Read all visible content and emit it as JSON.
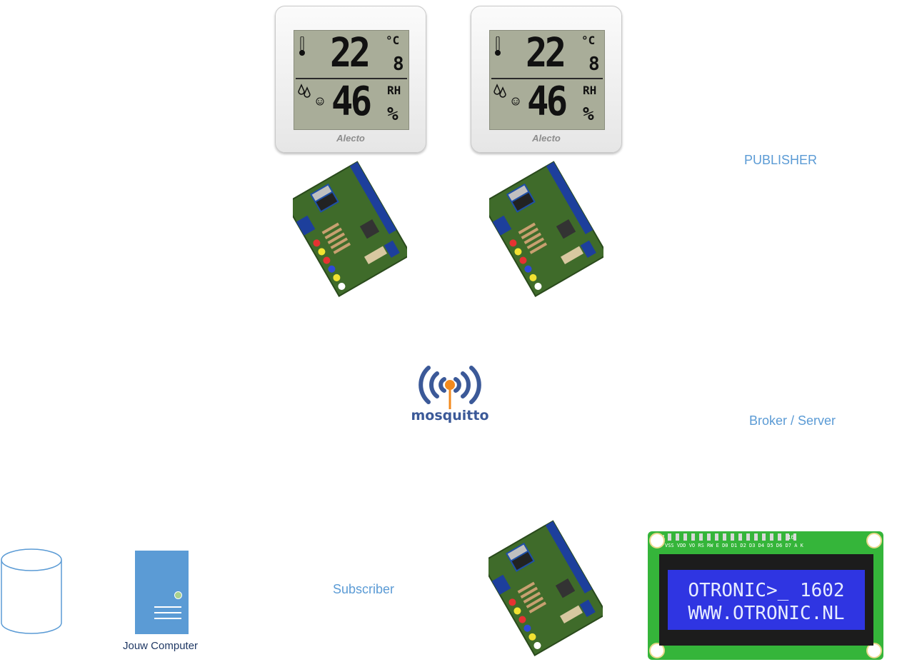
{
  "labels": {
    "publisher": "PUBLISHER",
    "broker": "Broker / Server",
    "subscriber": "Subscriber",
    "computer": "Jouw Computer"
  },
  "thermometers": [
    {
      "temp_main": "22",
      "temp_dec": "8",
      "temp_unit": "°C",
      "humidity": "46",
      "rh": "RH",
      "pct": "%",
      "brand": "Alecto"
    },
    {
      "temp_main": "22",
      "temp_dec": "8",
      "temp_unit": "°C",
      "humidity": "46",
      "rh": "RH",
      "pct": "%",
      "brand": "Alecto"
    }
  ],
  "mosquitto": {
    "logo_text": "mosquitto"
  },
  "lcd_module": {
    "line1": "OTRONIC>_ 1602",
    "line2": "WWW.OTRONIC.NL",
    "pin_labels": "VSS VDD VO RS RW E D0 D1 D2 D3 D4 D5 D6 D7 A K",
    "pin_1": "1",
    "pin_16": "16"
  },
  "colors": {
    "label_blue": "#5b9bd5",
    "server_blue": "#5b9bd5",
    "mosquitto_blue": "#3b5998",
    "mosquitto_orange": "#f28a1e",
    "lcd_blue": "#2f35e2",
    "pcb_green": "#3f6b2a"
  }
}
